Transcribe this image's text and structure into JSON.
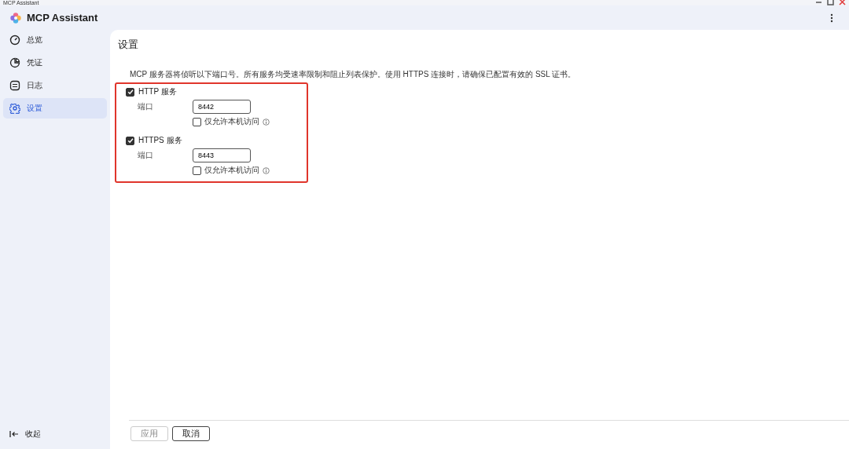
{
  "window": {
    "title": "MCP Assistant"
  },
  "app": {
    "name": "MCP Assistant"
  },
  "sidebar": {
    "items": [
      {
        "label": "总览",
        "kind": "overview",
        "selected": false
      },
      {
        "label": "凭证",
        "kind": "credentials",
        "selected": false
      },
      {
        "label": "日志",
        "kind": "logs",
        "selected": false
      },
      {
        "label": "设置",
        "kind": "settings",
        "selected": true
      }
    ],
    "collapse": {
      "label": "收起"
    }
  },
  "page": {
    "title": "设置",
    "description": "MCP 服务器将侦听以下端口号。所有服务均受速率限制和阻止列表保护。使用 HTTPS 连接时，请确保已配置有效的 SSL 证书。",
    "services": [
      {
        "label": "HTTP 服务",
        "checked": true,
        "port_label": "端口",
        "port": "8442",
        "local_only": {
          "label": "仅允许本机访问",
          "checked": false
        }
      },
      {
        "label": "HTTPS 服务",
        "checked": true,
        "port_label": "端口",
        "port": "8443",
        "local_only": {
          "label": "仅允许本机访问",
          "checked": false
        }
      }
    ]
  },
  "footer": {
    "buttons": [
      {
        "label": "应用",
        "disabled": true
      },
      {
        "label": "取消",
        "disabled": false
      }
    ]
  }
}
